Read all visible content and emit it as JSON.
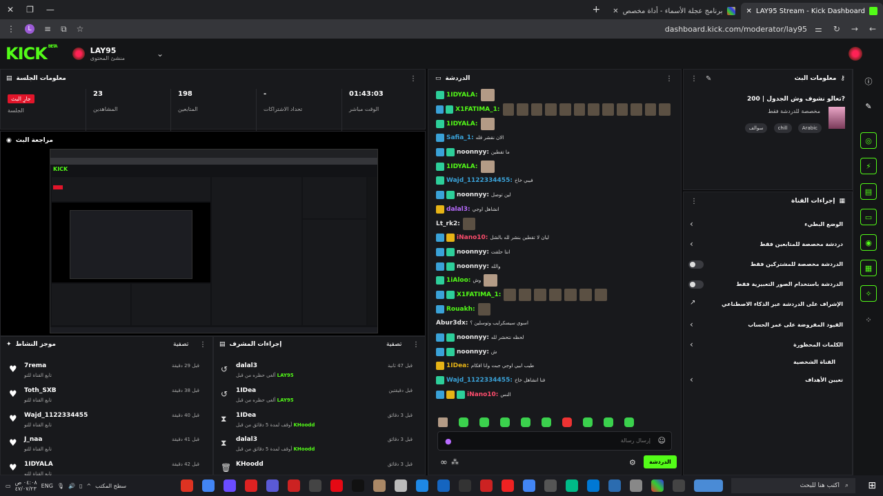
{
  "browser": {
    "tabs": [
      {
        "label": "LAY95 Stream - Kick Dashboard",
        "active": true
      },
      {
        "label": "برنامج عجلة الأسماء - أداة مخصص",
        "active": false
      }
    ],
    "url": "dashboard.kick.com/moderator/lay95",
    "profile_initial": "L"
  },
  "header": {
    "logo": "KICK",
    "beta": "BETA",
    "channel_name": "LAY95",
    "channel_role": "منشئ المحتوى"
  },
  "session": {
    "title": "معلومات الجلسة",
    "live_badge": "جارِ البث",
    "live_label": "الجلسة",
    "stats": [
      {
        "value": "23",
        "label": "المشاهدين"
      },
      {
        "value": "198",
        "label": "المتابعين"
      },
      {
        "value": "-",
        "label": "تحداد الاشتراكات"
      },
      {
        "value": "01:43:03",
        "label": "الوقت مباشر"
      }
    ]
  },
  "preview": {
    "title": "مراجعة البث"
  },
  "activity": {
    "title": "موجز النشاط",
    "filter": "تصفية",
    "items": [
      {
        "name": "7rema",
        "sub": "تابع القناة للتو",
        "time": "قبل 29 دقيقة"
      },
      {
        "name": "Toth_SXB",
        "sub": "تابع القناة للتو",
        "time": "قبل 38 دقيقة"
      },
      {
        "name": "Wajd_1122334455",
        "sub": "تابع القناة للتو",
        "time": "قبل 40 دقيقة"
      },
      {
        "name": "J_naa",
        "sub": "تابع القناة للتو",
        "time": "قبل 41 دقيقة"
      },
      {
        "name": "1IDYALA",
        "sub": "تابع القناة للتو",
        "time": "قبل 42 دقيقة"
      }
    ]
  },
  "modactions": {
    "title": "إجراءات المشرف",
    "filter": "تصفية",
    "items": [
      {
        "icon": "undo-icon",
        "glyph": "↺",
        "name": "dalal3",
        "sub": "ألغى حظره من قبل",
        "by": "LAY95",
        "time": "قبل 47 ثانية"
      },
      {
        "icon": "undo-icon",
        "glyph": "↺",
        "name": "1IDea",
        "sub": "ألغى حظره من قبل",
        "by": "LAY95",
        "time": "قبل دقيقتين"
      },
      {
        "icon": "hourglass-icon",
        "glyph": "⧗",
        "name": "1IDea",
        "sub": "أوقف لمدة 5 دقائق من قبل",
        "by": "KHoodd",
        "time": "قبل 3 دقائق"
      },
      {
        "icon": "hourglass-icon",
        "glyph": "⧗",
        "name": "dalal3",
        "sub": "أوقف لمدة 5 دقائق من قبل",
        "by": "KHoodd",
        "time": "قبل 3 دقائق"
      },
      {
        "icon": "trash-icon",
        "glyph": "🗑",
        "name": "KHoodd",
        "sub": "",
        "by": "",
        "time": "قبل 3 دقائق"
      }
    ]
  },
  "chat": {
    "title": "الدردشة",
    "placeholder": "إرسال رسالة",
    "send": "الدردشة",
    "messages": [
      {
        "badges": [
          "sub"
        ],
        "user": "1IDYALA:",
        "color": "#53fc18",
        "text": "",
        "emotes": 1,
        "face": true
      },
      {
        "badges": [
          "mod",
          "sub"
        ],
        "user": "X1FATIMA_1:",
        "color": "#53fc18",
        "text": "",
        "emotes": 12,
        "face": false
      },
      {
        "badges": [
          "sub"
        ],
        "user": "1IDYALA:",
        "color": "#53fc18",
        "text": "",
        "emotes": 1,
        "face": true
      },
      {
        "badges": [
          "mod"
        ],
        "user": "Safia_1:",
        "color": "#3aa2d8",
        "text": "الان نقشر قله",
        "emotes": 0,
        "face": false
      },
      {
        "badges": [
          "mod",
          "sub"
        ],
        "user": "noonnyy:",
        "color": "#e8e8e8",
        "text": "ما تقطين",
        "emotes": 0,
        "face": false
      },
      {
        "badges": [
          "sub"
        ],
        "user": "1IDYALA:",
        "color": "#53fc18",
        "text": "",
        "emotes": 1,
        "face": true
      },
      {
        "badges": [
          "sub"
        ],
        "user": "Wajd_1122334455:",
        "color": "#3aa2d8",
        "text": "فيبي خاخ",
        "emotes": 0,
        "face": false
      },
      {
        "badges": [
          "mod",
          "sub"
        ],
        "user": "noonnyy:",
        "color": "#e8e8e8",
        "text": "لين توصل",
        "emotes": 0,
        "face": false
      },
      {
        "badges": [
          "vip"
        ],
        "user": "dalal3:",
        "color": "#b86bff",
        "text": "انشاهل اوجي",
        "emotes": 0,
        "face": false
      },
      {
        "badges": [],
        "user": "Lt_rk2:",
        "color": "#e8e8e8",
        "text": "",
        "emotes": 1,
        "face": false
      },
      {
        "badges": [
          "mod",
          "vip"
        ],
        "user": "iNano10:",
        "color": "#ff4d6d",
        "text": "ليان لا تقطين بنشر لله بالشل",
        "emotes": 0,
        "face": false
      },
      {
        "badges": [
          "mod",
          "sub"
        ],
        "user": "noonnyy:",
        "color": "#e8e8e8",
        "text": "انتا حلقت",
        "emotes": 0,
        "face": false
      },
      {
        "badges": [
          "mod",
          "sub"
        ],
        "user": "noonnyy:",
        "color": "#e8e8e8",
        "text": "والله",
        "emotes": 0,
        "face": false
      },
      {
        "badges": [
          "sub"
        ],
        "user": "1iAloo:",
        "color": "#53fc18",
        "text": "وش",
        "emotes": 1,
        "face": true
      },
      {
        "badges": [
          "mod",
          "sub"
        ],
        "user": "X1FATIMA_1:",
        "color": "#53fc18",
        "text": "",
        "emotes": 7,
        "face": false
      },
      {
        "badges": [
          "mod"
        ],
        "user": "Rouakh:",
        "color": "#53fc18",
        "text": "",
        "emotes": 1,
        "face": false
      },
      {
        "badges": [],
        "user": "Abur3dx:",
        "color": "#e8e8e8",
        "text": "اسوي سيسكرايب وتوسلين ؟",
        "emotes": 0,
        "face": false
      },
      {
        "badges": [
          "mod",
          "sub"
        ],
        "user": "noonnyy:",
        "color": "#e8e8e8",
        "text": "لحظه نتحشر لله",
        "emotes": 0,
        "face": false
      },
      {
        "badges": [
          "mod",
          "sub"
        ],
        "user": "noonnyy:",
        "color": "#e8e8e8",
        "text": "ش",
        "emotes": 0,
        "face": false
      },
      {
        "badges": [
          "vip"
        ],
        "user": "1IDea:",
        "color": "#e7b416",
        "text": "طيب ابيي اوجي جبت وانا افكام",
        "emotes": 0,
        "face": false
      },
      {
        "badges": [
          "sub"
        ],
        "user": "Wajd_1122334455:",
        "color": "#3aa2d8",
        "text": "فنا انشاهل خاخ",
        "emotes": 0,
        "face": false
      },
      {
        "badges": [
          "mod",
          "vip",
          "sub"
        ],
        "user": "iNano10:",
        "color": "#ff4d6d",
        "text": "النس",
        "emotes": 0,
        "face": false
      }
    ]
  },
  "stream_info": {
    "title": "معلومات البث",
    "stream_title": "تعالو نشوف وش الجدول | 200?",
    "category": "مخصصة للدردشة فقط",
    "tags": [
      "Arabic",
      "chill",
      "سوالف"
    ]
  },
  "channel_actions": {
    "title": "إجراءات القناة",
    "rows": [
      {
        "label": "الوضع البطيء",
        "kind": "chevron"
      },
      {
        "label": "دردشة مخصصة للمتابعين فقط",
        "kind": "chevron"
      },
      {
        "label": "الدردشة مخصصة للمشتركين فقط",
        "kind": "toggle"
      },
      {
        "label": "الدردشة باستخدام الصور التعبيرية فقط",
        "kind": "toggle"
      },
      {
        "label": "الإشراف على الدردشة عبر الذكاء الاصطناعي",
        "kind": "link"
      },
      {
        "label": "القيود المفروضة على عمر الحساب",
        "kind": "chevron"
      },
      {
        "label": "الكلمات المحظورة",
        "kind": "chevron"
      }
    ],
    "section": "القناة الشخصية",
    "section_rows": [
      {
        "label": "تعيين الأهداف",
        "kind": "chevron"
      }
    ]
  },
  "taskbar": {
    "search": "اكتب هنا للبحث",
    "desktop": "سطح المكتب",
    "lang": "ENG",
    "time": "٠٤:٠٨ ص",
    "date": "٤٧/٠٧/٢٣"
  }
}
